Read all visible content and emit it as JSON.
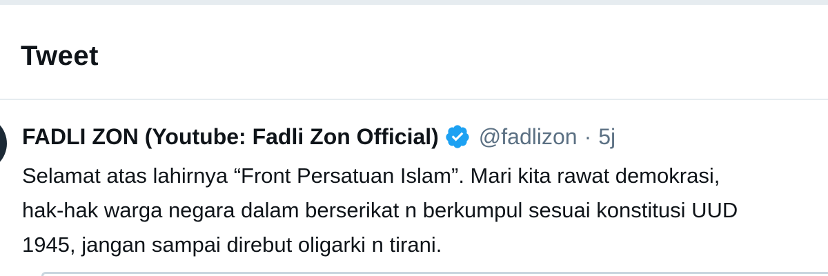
{
  "header": {
    "title": "Tweet"
  },
  "tweet": {
    "display_name": "FADLI ZON (Youtube: Fadli Zon Official)",
    "verified_icon": "verified-badge-icon",
    "handle": "@fadlizon",
    "separator": "·",
    "timestamp": "5j",
    "text_lines": [
      "Selamat atas lahirnya “Front Persatuan Islam”. Mari kita rawat demokrasi,",
      "hak-hak warga negara dalam berserikat n berkumpul sesuai konstitusi UUD",
      "1945, jangan sampai direbut oligarki n tirani."
    ]
  },
  "colors": {
    "text_primary": "#0f1419",
    "text_secondary": "#5b7083",
    "verified_blue": "#1da1f2",
    "divider": "#e6ecf0"
  }
}
